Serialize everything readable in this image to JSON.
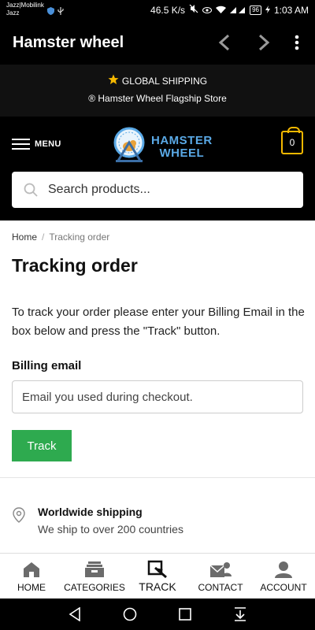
{
  "status_bar": {
    "carrier_line1": "Jazz|Mobilink",
    "carrier_line2": "Jazz",
    "speed": "46.5 K/s",
    "battery": "96",
    "time": "1:03 AM"
  },
  "app_bar": {
    "title": "Hamster wheel",
    "icons": [
      "back-arrow-icon",
      "forward-arrow-icon",
      "more-vert-icon"
    ]
  },
  "promo": {
    "shipping": "GLOBAL SHIPPING",
    "store": "® Hamster Wheel Flagship Store"
  },
  "header": {
    "menu_label": "MENU",
    "logo_line1": "HAMSTER",
    "logo_line2": "WHEEL",
    "cart_count": "0",
    "search_placeholder": "Search products..."
  },
  "breadcrumb": {
    "home": "Home",
    "separator": "/",
    "current": "Tracking order"
  },
  "page": {
    "title": "Tracking order",
    "description": "To track your order please enter your Billing Email in the box below and press the \"Track\" button.",
    "field_label": "Billing email",
    "email_placeholder": "Email you used during checkout.",
    "track_button": "Track"
  },
  "features": [
    {
      "title": "Worldwide shipping",
      "subtitle": "We ship to over 200 countries",
      "icon": "location-pin-icon"
    }
  ],
  "tabs": [
    {
      "label": "HOME",
      "icon": "home-icon"
    },
    {
      "label": "CATEGORIES",
      "icon": "categories-icon"
    },
    {
      "label": "TRACK",
      "icon": "track-icon"
    },
    {
      "label": "CONTACT",
      "icon": "contact-icon"
    },
    {
      "label": "ACCOUNT",
      "icon": "account-icon"
    }
  ],
  "colors": {
    "accent_green": "#2eaa4f",
    "logo_blue": "#5aa9e6",
    "cart_yellow": "#f5b800"
  }
}
